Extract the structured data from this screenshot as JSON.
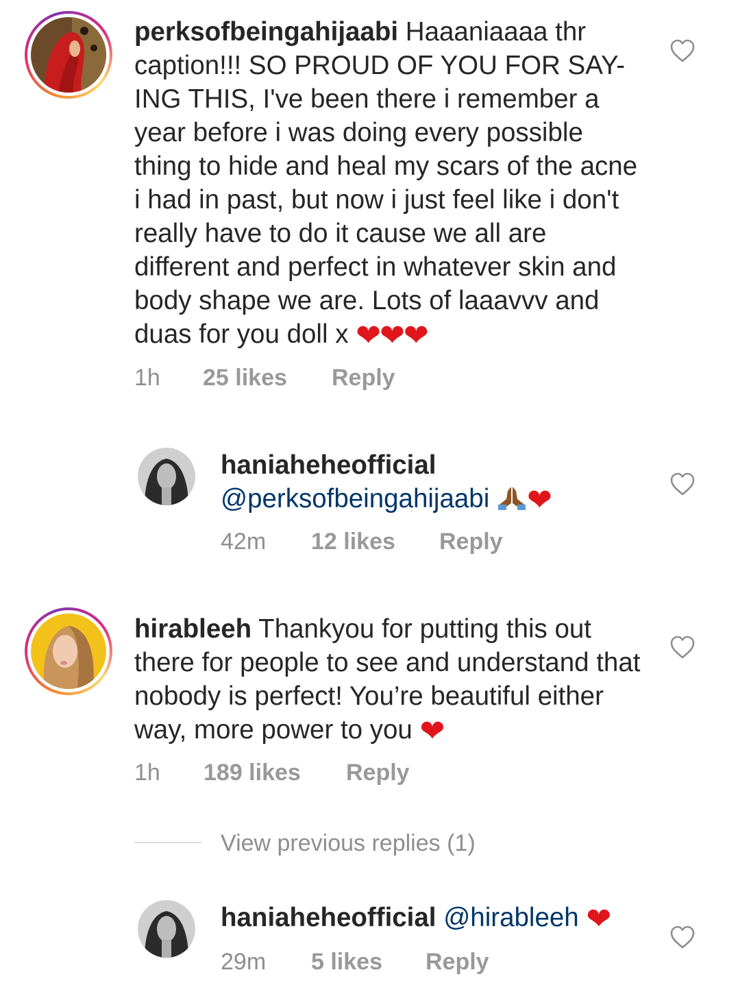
{
  "comments": [
    {
      "username": "perksofbeingahijaabi",
      "text": " Haaaniaaaa thr caption!!! SO PROUD OF YOU FOR SAY-ING THIS, I've been there i remember a year before i was doing every possible thing to hide and heal my scars of the acne i had in past, but now i just feel like i don't really have to do it cause we all are different and perfect in whatever skin and body shape we are. Lots of laaavvv and duas for you doll x ",
      "emoji": "❤❤❤",
      "time": "1h",
      "likes": "25 likes",
      "reply": "Reply"
    },
    {
      "username": "haniaheheofficial",
      "mention": "@perksofbeingahijaabi",
      "emoji": "❤",
      "time": "42m",
      "likes": "12 likes",
      "reply": "Reply"
    },
    {
      "username": "hirableeh",
      "text": " Thankyou for putting this out there for people to see and understand that nobody is perfect! You’re beautiful either way, more power to you ",
      "emoji": "❤",
      "time": "1h",
      "likes": "189 likes",
      "reply": "Reply"
    },
    {
      "username": "haniaheheofficial",
      "mention": "@hirableeh",
      "emoji": "❤",
      "time": "29m",
      "likes": "5 likes",
      "reply": "Reply"
    }
  ],
  "view_previous": "View previous replies (1)",
  "icons": {
    "like": "heart-outline-icon",
    "pray": "folded-hands-emoji"
  },
  "colors": {
    "mention": "#003569",
    "meta": "#8e8e8e",
    "heart": "#e0161c"
  }
}
